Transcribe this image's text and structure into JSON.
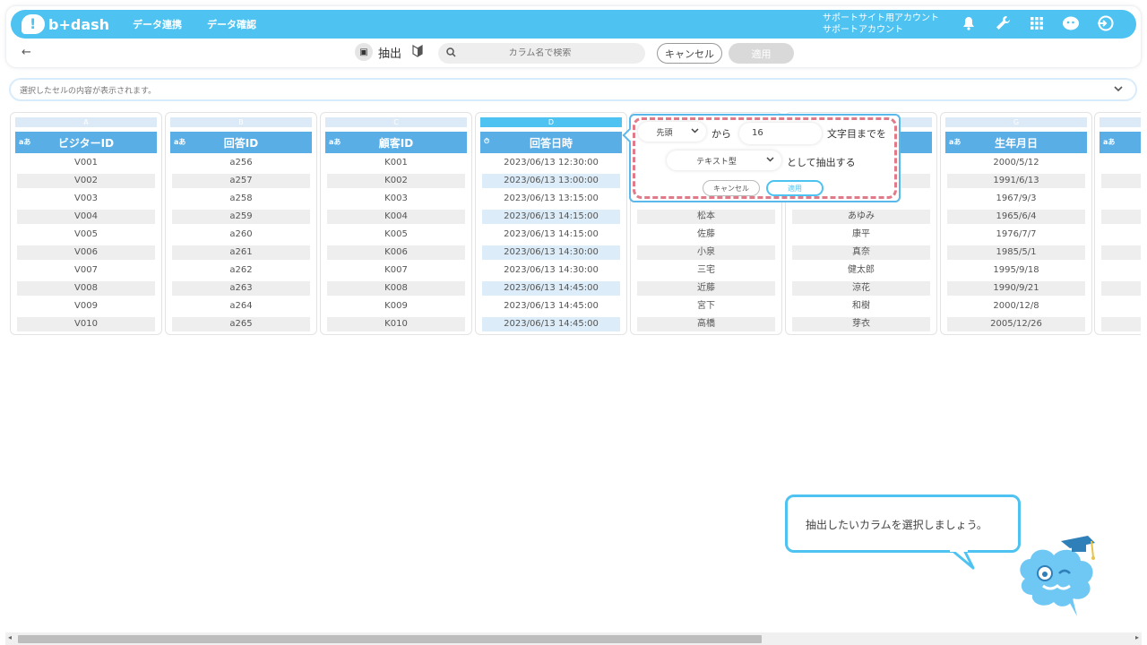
{
  "header": {
    "logo_text": "b+dash",
    "nav": [
      "データ連携",
      "データ確認"
    ],
    "account_line1": "サポートサイト用アカウント",
    "account_line2": "サポートアカウント",
    "icons": [
      "bell-icon",
      "wrench-icon",
      "apps-grid-icon",
      "mascot-icon",
      "logout-icon"
    ]
  },
  "toolbar": {
    "back_glyph": "←",
    "title": "抽出",
    "search_placeholder": "カラム名で検索",
    "cancel_label": "キャンセル",
    "apply_label": "適用"
  },
  "cellbar": {
    "placeholder": "選択したセルの内容が表示されます。"
  },
  "columns": [
    {
      "letter": "A",
      "type": "aあ",
      "name": "ビジターID",
      "cells": [
        "V001",
        "V002",
        "V003",
        "V004",
        "V005",
        "V006",
        "V007",
        "V008",
        "V009",
        "V010"
      ]
    },
    {
      "letter": "B",
      "type": "aあ",
      "name": "回答ID",
      "cells": [
        "a256",
        "a257",
        "a258",
        "a259",
        "a260",
        "a261",
        "a262",
        "a263",
        "a264",
        "a265"
      ]
    },
    {
      "letter": "C",
      "type": "aあ",
      "name": "顧客ID",
      "cells": [
        "K001",
        "K002",
        "K003",
        "K004",
        "K005",
        "K006",
        "K007",
        "K008",
        "K009",
        "K010"
      ]
    },
    {
      "letter": "D",
      "type": "⏱",
      "name": "回答日時",
      "cells": [
        "2023/06/13 12:30:00",
        "2023/06/13 13:00:00",
        "2023/06/13 13:15:00",
        "2023/06/13 14:15:00",
        "2023/06/13 14:15:00",
        "2023/06/13 14:30:00",
        "2023/06/13 14:30:00",
        "2023/06/13 14:45:00",
        "2023/06/13 14:45:00",
        "2023/06/13 14:45:00"
      ]
    },
    {
      "letter": "",
      "type": "",
      "name": "",
      "cells": [
        "",
        "",
        "",
        "松本",
        "佐藤",
        "小泉",
        "三宅",
        "近藤",
        "宮下",
        "高橋"
      ]
    },
    {
      "letter": "",
      "type": "",
      "name": "",
      "cells": [
        "",
        "",
        "",
        "あゆみ",
        "康平",
        "真奈",
        "健太郎",
        "涼花",
        "和樹",
        "芽衣"
      ]
    },
    {
      "letter": "G",
      "type": "aあ",
      "name": "生年月日",
      "cells": [
        "2000/5/12",
        "1991/6/13",
        "1967/9/3",
        "1965/6/4",
        "1976/7/7",
        "1985/5/1",
        "1995/9/18",
        "1990/9/21",
        "2000/12/8",
        "2005/12/26"
      ]
    },
    {
      "letter": "",
      "type": "aあ",
      "name": "",
      "cells": [
        "",
        "",
        "",
        "",
        "",
        "",
        "",
        "",
        "",
        ""
      ]
    }
  ],
  "popover": {
    "position_value": "先頭",
    "from_text": "から",
    "count_value": "16",
    "to_text": "文字目までを",
    "type_value": "テキスト型",
    "as_text": "として抽出する",
    "cancel_label": "キャンセル",
    "apply_label": "適用"
  },
  "tooltip": {
    "text": "抽出したいカラムを選択しましょう。"
  }
}
